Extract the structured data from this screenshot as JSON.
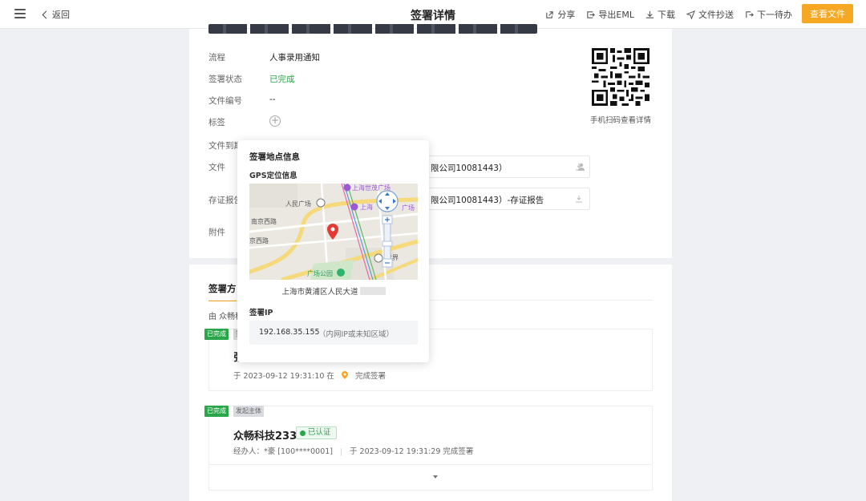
{
  "header": {
    "back_label": "返回",
    "title": "签署详情",
    "actions": [
      {
        "label": "分享",
        "icon": "share-icon"
      },
      {
        "label": "导出EML",
        "icon": "export-icon"
      },
      {
        "label": "下载",
        "icon": "download-icon"
      },
      {
        "label": "文件抄送",
        "icon": "send-icon"
      },
      {
        "label": "下一待办",
        "icon": "next-icon"
      }
    ],
    "primary_button": "查看文件"
  },
  "details": {
    "rows": [
      {
        "label": "流程",
        "value": "人事录用通知"
      },
      {
        "label": "签署状态",
        "value": "已完成"
      },
      {
        "label": "文件编号",
        "value": "--"
      },
      {
        "label": "标签",
        "value": ""
      },
      {
        "label": "文件到期",
        "value": ""
      },
      {
        "label": "文件",
        "value": "限公司10081443）"
      },
      {
        "label": "存证报告",
        "value": "限公司10081443）-存证报告"
      },
      {
        "label": "附件",
        "value": ""
      }
    ],
    "qr_caption": "手机扫码查看详情"
  },
  "signers": {
    "tab_label": "签署方",
    "order_note": "由 众畅科",
    "list": [
      {
        "status_tag": "已完成",
        "type_tag": "签",
        "name": "张",
        "time_text": "于 2023-09-12 19:31:10 在",
        "action_text": "完成签署"
      },
      {
        "status_tag": "已完成",
        "type_tag": "发起主体",
        "name": "众畅科技233",
        "verified_label": "已认证",
        "operator_text": "经办人：*豪 [100****0001]",
        "time_text": "于 2023-09-12 19:31:29 完成签署"
      }
    ]
  },
  "popover": {
    "title": "签署地点信息",
    "gps_label": "GPS定位信息",
    "map_labels": {
      "poi_1": "上海世茂广场",
      "poi_2": "上海",
      "poi_2b": "广场",
      "square": "人民广场",
      "road_1": "南京西路",
      "road_2": "京西路",
      "park": "广场公园",
      "market": "世界"
    },
    "address": "上海市黄浦区人民大道",
    "ip_label": "签署IP",
    "ip": "192.168.35.155",
    "ip_note": "（内网IP或未知区域）"
  },
  "colors": {
    "accent": "#f7a823",
    "success": "#2aa64a",
    "map_pin": "#e53935"
  }
}
